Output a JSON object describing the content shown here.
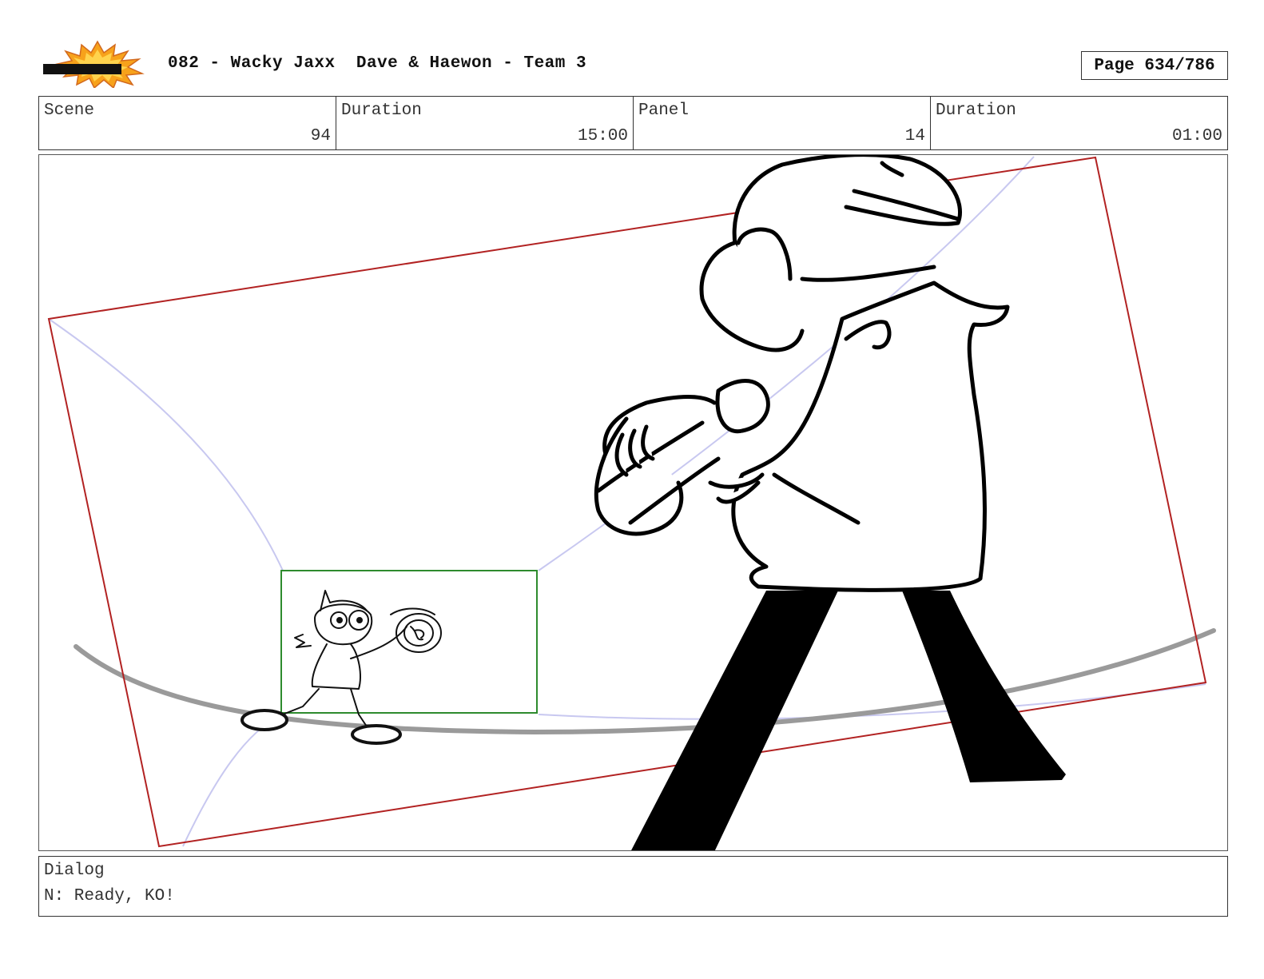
{
  "header": {
    "logo": {
      "icon": "toon-boom-logo-icon",
      "text": "TOON BOOM"
    },
    "title": "082 - Wacky Jaxx  Dave & Haewon - Team 3",
    "page": "Page 634/786"
  },
  "info": {
    "scene_label": "Scene",
    "scene_value": "94",
    "scene_duration_label": "Duration",
    "scene_duration_value": "15:00",
    "panel_label": "Panel",
    "panel_value": "14",
    "panel_duration_label": "Duration",
    "panel_duration_value": "01:00"
  },
  "panel_art": {
    "description_icon": "storyboard-sketch-icon",
    "colors": {
      "camera_frame": "#b22222",
      "field_box": "#2e8b2e",
      "guide_lines": "#c8c8f0",
      "ground_line": "#999999",
      "ink": "#000000"
    }
  },
  "dialog": {
    "label": "Dialog",
    "text": "N: Ready, KO!"
  }
}
